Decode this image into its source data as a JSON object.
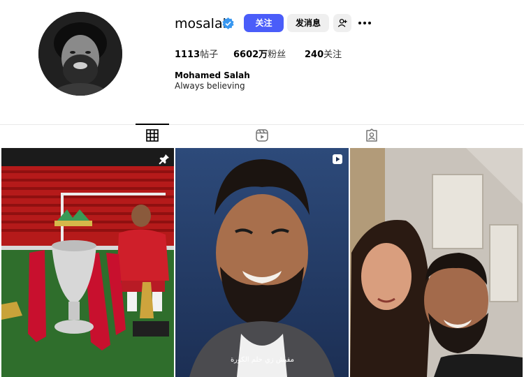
{
  "profile": {
    "username": "mosalah",
    "verified": true,
    "follow_label": "关注",
    "message_label": "发消息",
    "stats": {
      "posts_count": "1113",
      "posts_label": "帖子",
      "followers_count": "6602万",
      "followers_label": "粉丝",
      "following_count": "240",
      "following_label": "关注"
    },
    "full_name": "Mohamed Salah",
    "bio": "Always believing"
  },
  "icons": {
    "verified": "verified-badge-icon",
    "suggest": "add-person-icon",
    "more": "more-options-icon",
    "tab_posts": "grid-icon",
    "tab_reels": "reels-icon",
    "tab_tagged": "tagged-icon",
    "pinned": "pin-icon",
    "reel": "reel-icon"
  },
  "tabs": {
    "active": "posts"
  },
  "posts": [
    {
      "type": "image",
      "pinned": true
    },
    {
      "type": "reel",
      "caption": "مفيش زي حلم الكورة"
    },
    {
      "type": "image"
    }
  ],
  "colors": {
    "follow_button": "#4a5df9",
    "secondary_button": "#efefef",
    "verified": "#3897f0"
  }
}
